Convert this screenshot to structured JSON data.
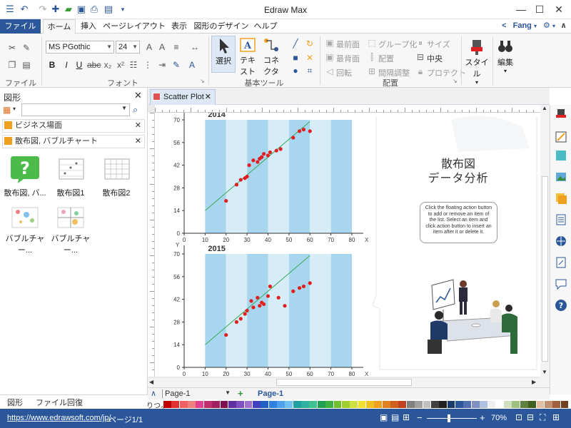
{
  "app": {
    "title": "Edraw Max"
  },
  "tabs": [
    {
      "label": "ファイル"
    },
    {
      "label": "ホーム"
    },
    {
      "label": "挿入"
    },
    {
      "label": "ページレイアウト"
    },
    {
      "label": "表示"
    },
    {
      "label": "図形のデザイン"
    },
    {
      "label": "ヘルプ"
    }
  ],
  "user": {
    "name": "Fang"
  },
  "ribbon": {
    "font_name": "MS PGothic",
    "font_size": "24",
    "groups": {
      "file": "ファイル",
      "font": "フォント",
      "tools": "基本ツール",
      "arrange": "配置"
    },
    "tools": {
      "select": "選択",
      "text": "テキスト",
      "connector": "コネクタ"
    },
    "arrange": {
      "bring_front": "最前面",
      "send_back": "最背面",
      "rotate": "回転",
      "group": "グループ化",
      "align": "配置",
      "spacing": "間隔調整",
      "size": "サイズ",
      "center": "中央",
      "protect": "プロテクト"
    },
    "style": "スタイル",
    "edit": "編集"
  },
  "left_pane": {
    "title": "図形",
    "search_placeholder": "",
    "libraries": [
      {
        "label": "ビジネス場面"
      },
      {
        "label": "散布図, バブルチャート"
      }
    ],
    "shapes": [
      {
        "label": "散布図, バ..."
      },
      {
        "label": "散布図1"
      },
      {
        "label": "散布図2"
      },
      {
        "label": "バブルチャー..."
      },
      {
        "label": "バブルチャー..."
      }
    ],
    "bottom_tabs": [
      "図形",
      "ファイル回復"
    ]
  },
  "document": {
    "tab_label": "Scatter Plot",
    "heading_line1": "散布図",
    "heading_line2": "データ分析",
    "callout_text": "Click the floating action button to add or remove an item of the list. Select an item and click action button to insert an item after it or delete it."
  },
  "pagebar": {
    "page_select": "Page-1",
    "page_tab": "Page-1"
  },
  "palette_label": "りつぶ",
  "status": {
    "url": "https://www.edrawsoft.com/jp/",
    "page": "ページ1/1",
    "zoom": "70%"
  },
  "colors": {
    "accent": "#2b579a",
    "plot_bg_light": "#d6ecf7",
    "plot_bg_dark": "#a8d6ee",
    "point": "#e02020",
    "trend": "#3aa85a"
  },
  "chart_data": [
    {
      "type": "scatter",
      "title": "2014",
      "xlabel": "X",
      "ylabel": "Y",
      "xlim": [
        0,
        80
      ],
      "ylim": [
        0,
        70
      ],
      "xticks": [
        0,
        10,
        20,
        30,
        40,
        50,
        60,
        70,
        80
      ],
      "yticks": [
        0,
        14,
        28,
        42,
        56,
        70
      ],
      "trend": [
        [
          10,
          14
        ],
        [
          60,
          69
        ]
      ],
      "points": [
        [
          20,
          20
        ],
        [
          25,
          30
        ],
        [
          27,
          33
        ],
        [
          29,
          34
        ],
        [
          30,
          35
        ],
        [
          31,
          42
        ],
        [
          33,
          45
        ],
        [
          35,
          44
        ],
        [
          36,
          46
        ],
        [
          37,
          47
        ],
        [
          38,
          49
        ],
        [
          40,
          48
        ],
        [
          41,
          50
        ],
        [
          44,
          51
        ],
        [
          46,
          52
        ],
        [
          52,
          59
        ],
        [
          55,
          63
        ],
        [
          57,
          64
        ],
        [
          60,
          63
        ]
      ]
    },
    {
      "type": "scatter",
      "title": "2015",
      "xlabel": "X",
      "ylabel": "Y",
      "xlim": [
        0,
        80
      ],
      "ylim": [
        0,
        70
      ],
      "xticks": [
        0,
        10,
        20,
        30,
        40,
        50,
        60,
        70,
        80
      ],
      "yticks": [
        0,
        14,
        28,
        42,
        56,
        70
      ],
      "trend": [
        [
          10,
          14
        ],
        [
          60,
          69
        ]
      ],
      "points": [
        [
          20,
          20
        ],
        [
          25,
          28
        ],
        [
          27,
          30
        ],
        [
          29,
          33
        ],
        [
          30,
          35
        ],
        [
          32,
          41
        ],
        [
          33,
          37
        ],
        [
          35,
          43
        ],
        [
          36,
          38
        ],
        [
          37,
          40
        ],
        [
          38,
          39
        ],
        [
          40,
          44
        ],
        [
          41,
          50
        ],
        [
          45,
          43
        ],
        [
          48,
          38
        ],
        [
          52,
          47
        ],
        [
          55,
          49
        ],
        [
          57,
          50
        ],
        [
          60,
          52
        ]
      ]
    }
  ]
}
